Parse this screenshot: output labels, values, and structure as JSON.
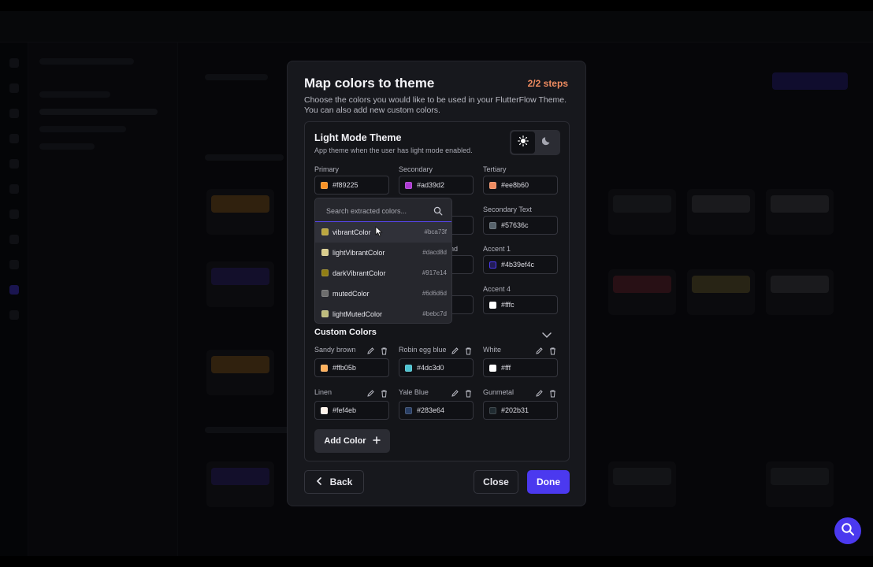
{
  "modal": {
    "title": "Map colors to theme",
    "steps": "2/2 steps",
    "description": "Choose the colors you would like to be used in your FlutterFlow Theme. You can also add new custom colors."
  },
  "theme_panel": {
    "title": "Light Mode Theme",
    "subtitle": "App theme when the user has light mode enabled.",
    "mode_toggle": {
      "options": [
        "light-mode",
        "dark-mode"
      ],
      "selected": "light-mode"
    },
    "fields": [
      {
        "label": "Primary",
        "hex": "#f89225",
        "color": "#f89225"
      },
      {
        "label": "Secondary",
        "hex": "#ad39d2",
        "color": "#ad39d2"
      },
      {
        "label": "Tertiary",
        "hex": "#ee8b60",
        "color": "#ee8b60"
      },
      {
        "label": "Secondary Text",
        "hex": "#57636c",
        "color": "#57636c"
      },
      {
        "label": "ound",
        "hex": "",
        "color": ""
      },
      {
        "label": "Accent 1",
        "hex": "#4b39ef4c",
        "color": "#4b39ef"
      },
      {
        "label": "Accent 4",
        "hex": "#fffc",
        "color": "#ffffff"
      }
    ]
  },
  "dropdown": {
    "search_placeholder": "Search extracted colors...",
    "items": [
      {
        "name": "vibrantColor",
        "hex": "#bca73f",
        "color": "#bca73f"
      },
      {
        "name": "lightVibrantColor",
        "hex": "#dacd8d",
        "color": "#dacd8d"
      },
      {
        "name": "darkVibrantColor",
        "hex": "#917e14",
        "color": "#917e14"
      },
      {
        "name": "mutedColor",
        "hex": "#6d6d6d",
        "color": "#6d6d6d"
      },
      {
        "name": "lightMutedColor",
        "hex": "#bebc7d",
        "color": "#bebc7d"
      }
    ]
  },
  "custom_colors": {
    "title": "Custom Colors",
    "items": [
      {
        "name": "Sandy brown",
        "hex": "#ffb05b",
        "color": "#ffb05b"
      },
      {
        "name": "Robin egg blue",
        "hex": "#4dc3d0",
        "color": "#4dc3d0"
      },
      {
        "name": "White",
        "hex": "#fff",
        "color": "#ffffff"
      },
      {
        "name": "Linen",
        "hex": "#fef4eb",
        "color": "#fef4eb"
      },
      {
        "name": "Yale Blue",
        "hex": "#283e64",
        "color": "#283e64"
      },
      {
        "name": "Gunmetal",
        "hex": "#202b31",
        "color": "#202b31"
      }
    ],
    "add_label": "Add Color"
  },
  "footer": {
    "back_label": "Back",
    "close_label": "Close",
    "done_label": "Done"
  },
  "colors": {
    "accent": "#4b39ef",
    "steps": "#ee8b60",
    "modal_bg": "#17181d"
  },
  "icons": {
    "light_mode": "sun-icon",
    "dark_mode": "moon-icon",
    "search": "search-icon",
    "chevron": "chevron-down-icon",
    "edit": "pencil-icon",
    "delete": "trash-icon",
    "add": "plus-icon",
    "back": "chevron-left-icon",
    "help": "search-icon"
  }
}
